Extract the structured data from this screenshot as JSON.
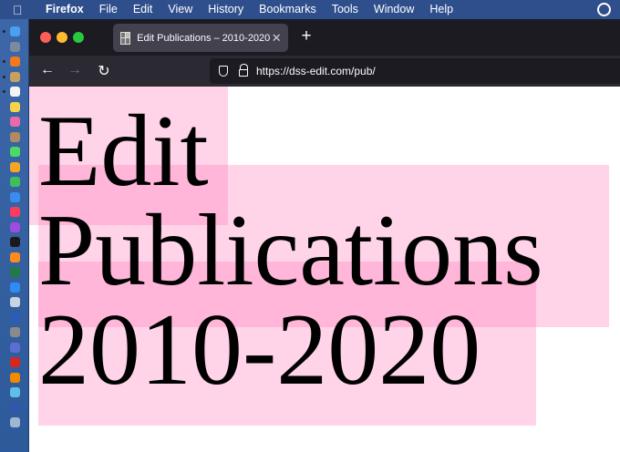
{
  "menubar": {
    "app_name": "Firefox",
    "items": [
      "File",
      "Edit",
      "View",
      "History",
      "Bookmarks",
      "Tools",
      "Window",
      "Help"
    ]
  },
  "dock": {
    "icons": [
      {
        "name": "finder-icon",
        "color": "#4aa0f0"
      },
      {
        "name": "launchpad-icon",
        "color": "#7a8aa0"
      },
      {
        "name": "firefox-icon",
        "color": "#f27a1a"
      },
      {
        "name": "app-icon",
        "color": "#c8a060"
      },
      {
        "name": "calendar-icon",
        "color": "#f4f4f4"
      },
      {
        "name": "notes-icon",
        "color": "#f7d34a"
      },
      {
        "name": "photos-icon",
        "color": "#e86aa8"
      },
      {
        "name": "contacts-icon",
        "color": "#b08a60"
      },
      {
        "name": "messages-icon",
        "color": "#4cd964"
      },
      {
        "name": "pages-icon",
        "color": "#f5a623"
      },
      {
        "name": "numbers-icon",
        "color": "#3fbf5a"
      },
      {
        "name": "keynote-icon",
        "color": "#3d8bf0"
      },
      {
        "name": "music-icon",
        "color": "#fb3d5d"
      },
      {
        "name": "podcasts-icon",
        "color": "#9b4de0"
      },
      {
        "name": "tv-icon",
        "color": "#1a1a1a"
      },
      {
        "name": "books-icon",
        "color": "#ff8a1e"
      },
      {
        "name": "excel-icon",
        "color": "#1f7a44"
      },
      {
        "name": "app-store-icon",
        "color": "#2f8cf5"
      },
      {
        "name": "preview-icon",
        "color": "#c8d4e0"
      },
      {
        "name": "word-icon",
        "color": "#2b5cb8"
      },
      {
        "name": "system-preferences-icon",
        "color": "#8a8a8a"
      },
      {
        "name": "accessibility-icon",
        "color": "#5b6fd0"
      },
      {
        "name": "acrobat-icon",
        "color": "#d7261e"
      },
      {
        "name": "vlc-icon",
        "color": "#f28a00"
      },
      {
        "name": "app-icon",
        "color": "#5ec0e8"
      },
      {
        "name": "app-icon",
        "color": "#3355aa"
      },
      {
        "name": "trash-icon",
        "color": "#9fb7cf"
      }
    ]
  },
  "browser": {
    "tab_title": "Edit Publications – 2010-2020",
    "url": "https://dss-edit.com/pub/"
  },
  "page": {
    "heading_line1": "Edit",
    "heading_line2": "Publications",
    "heading_line3": "2010-2020"
  }
}
